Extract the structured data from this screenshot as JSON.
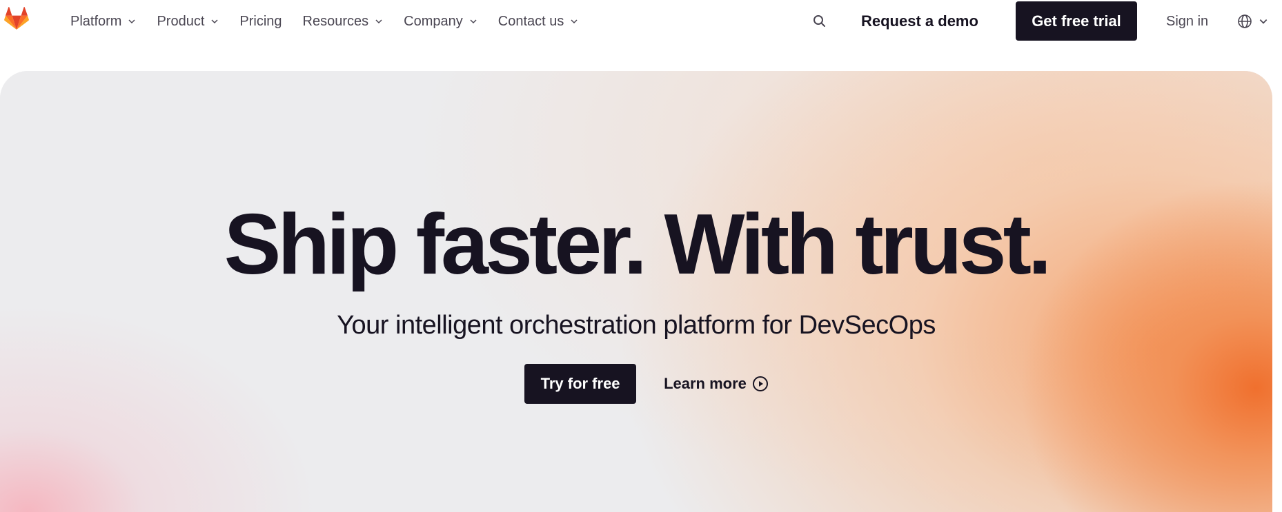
{
  "header": {
    "logo_icon": "gitlab-tanuki-icon",
    "nav": [
      {
        "label": "Platform",
        "has_dropdown": true
      },
      {
        "label": "Product",
        "has_dropdown": true
      },
      {
        "label": "Pricing",
        "has_dropdown": false
      },
      {
        "label": "Resources",
        "has_dropdown": true
      },
      {
        "label": "Company",
        "has_dropdown": true
      },
      {
        "label": "Contact us",
        "has_dropdown": true
      }
    ],
    "search_icon": "search-icon",
    "request_demo_label": "Request a demo",
    "free_trial_label": "Get free trial",
    "sign_in_label": "Sign in",
    "language_icon": "globe-icon"
  },
  "hero": {
    "title": "Ship faster. With trust.",
    "subtitle": "Your intelligent orchestration platform for DevSecOps",
    "primary_cta_label": "Try for free",
    "secondary_cta_label": "Learn more",
    "secondary_cta_icon": "play-circle-icon"
  },
  "colors": {
    "brand_dark": "#171321",
    "nav_text": "#4a4652",
    "accent_orange": "#f0702e",
    "logo_orange": "#e24329",
    "logo_light_orange": "#fca326",
    "hero_pink": "#f6b4be"
  }
}
